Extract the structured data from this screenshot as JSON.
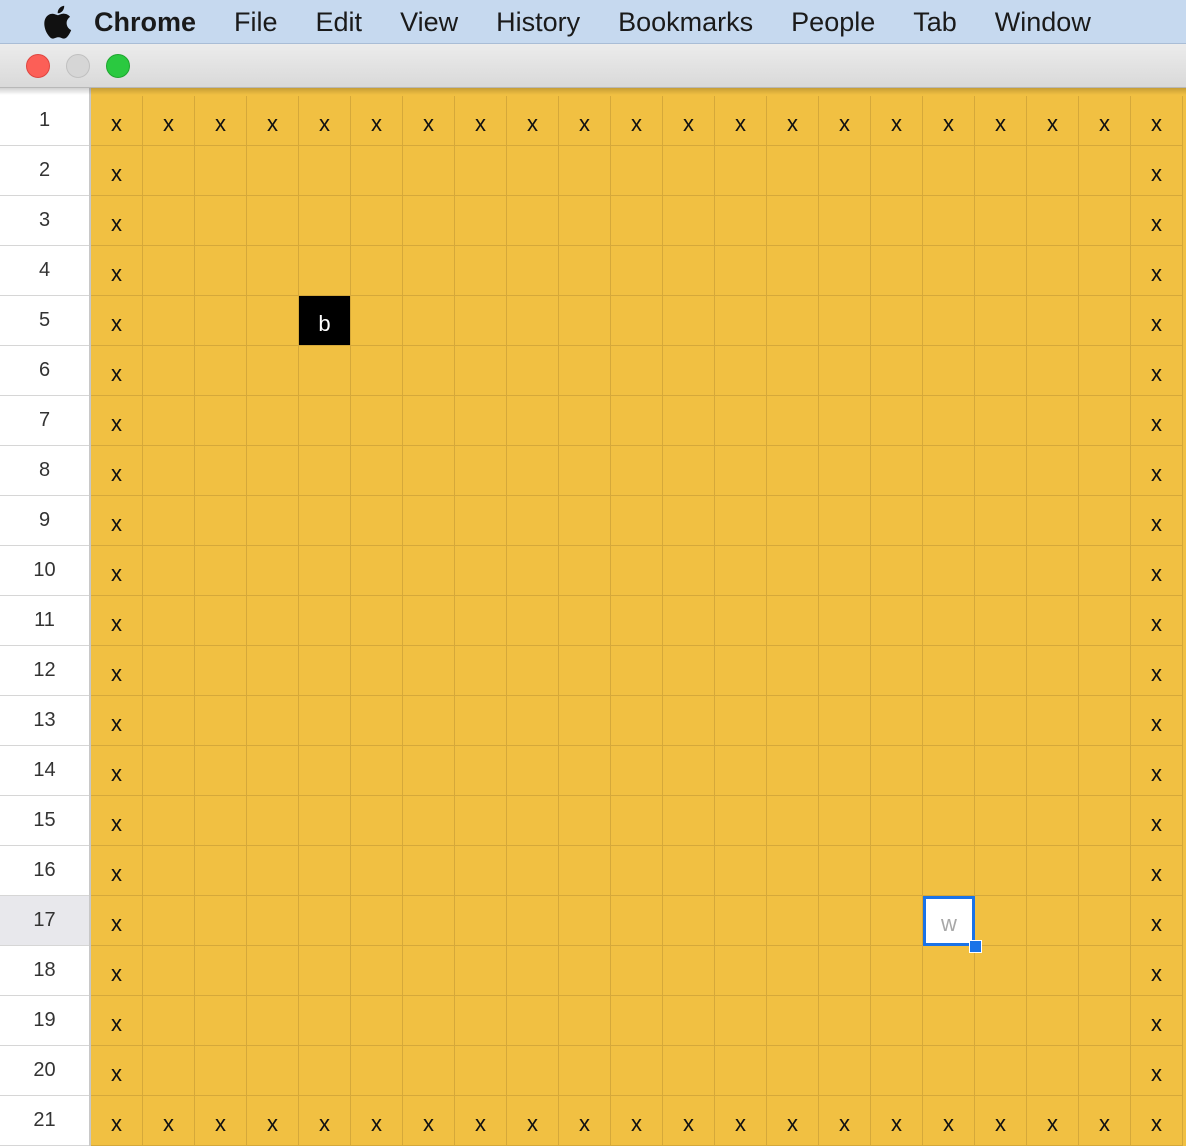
{
  "menubar": {
    "apple_icon": "apple-logo",
    "items": [
      "Chrome",
      "File",
      "Edit",
      "View",
      "History",
      "Bookmarks",
      "People",
      "Tab",
      "Window"
    ]
  },
  "window_controls": [
    "close",
    "minimize",
    "maximize"
  ],
  "colors": {
    "cell_background": "#f1c042",
    "grid_line": "#d5a83a",
    "highlight_cell": "#000000",
    "selection": "#1a73e8"
  },
  "sheet": {
    "columns": 21,
    "row_labels": [
      "1",
      "2",
      "3",
      "4",
      "5",
      "6",
      "7",
      "8",
      "9",
      "10",
      "11",
      "12",
      "13",
      "14",
      "15",
      "16",
      "17",
      "18",
      "19",
      "20",
      "21"
    ],
    "active_row": "17",
    "rows": [
      [
        "x",
        "x",
        "x",
        "x",
        "x",
        "x",
        "x",
        "x",
        "x",
        "x",
        "x",
        "x",
        "x",
        "x",
        "x",
        "x",
        "x",
        "x",
        "x",
        "x",
        "x"
      ],
      [
        "x",
        "",
        "",
        "",
        "",
        "",
        "",
        "",
        "",
        "",
        "",
        "",
        "",
        "",
        "",
        "",
        "",
        "",
        "",
        "",
        "x"
      ],
      [
        "x",
        "",
        "",
        "",
        "",
        "",
        "",
        "",
        "",
        "",
        "",
        "",
        "",
        "",
        "",
        "",
        "",
        "",
        "",
        "",
        "x"
      ],
      [
        "x",
        "",
        "",
        "",
        "",
        "",
        "",
        "",
        "",
        "",
        "",
        "",
        "",
        "",
        "",
        "",
        "",
        "",
        "",
        "",
        "x"
      ],
      [
        "x",
        "",
        "",
        "",
        "b",
        "",
        "",
        "",
        "",
        "",
        "",
        "",
        "",
        "",
        "",
        "",
        "",
        "",
        "",
        "",
        "x"
      ],
      [
        "x",
        "",
        "",
        "",
        "",
        "",
        "",
        "",
        "",
        "",
        "",
        "",
        "",
        "",
        "",
        "",
        "",
        "",
        "",
        "",
        "x"
      ],
      [
        "x",
        "",
        "",
        "",
        "",
        "",
        "",
        "",
        "",
        "",
        "",
        "",
        "",
        "",
        "",
        "",
        "",
        "",
        "",
        "",
        "x"
      ],
      [
        "x",
        "",
        "",
        "",
        "",
        "",
        "",
        "",
        "",
        "",
        "",
        "",
        "",
        "",
        "",
        "",
        "",
        "",
        "",
        "",
        "x"
      ],
      [
        "x",
        "",
        "",
        "",
        "",
        "",
        "",
        "",
        "",
        "",
        "",
        "",
        "",
        "",
        "",
        "",
        "",
        "",
        "",
        "",
        "x"
      ],
      [
        "x",
        "",
        "",
        "",
        "",
        "",
        "",
        "",
        "",
        "",
        "",
        "",
        "",
        "",
        "",
        "",
        "",
        "",
        "",
        "",
        "x"
      ],
      [
        "x",
        "",
        "",
        "",
        "",
        "",
        "",
        "",
        "",
        "",
        "",
        "",
        "",
        "",
        "",
        "",
        "",
        "",
        "",
        "",
        "x"
      ],
      [
        "x",
        "",
        "",
        "",
        "",
        "",
        "",
        "",
        "",
        "",
        "",
        "",
        "",
        "",
        "",
        "",
        "",
        "",
        "",
        "",
        "x"
      ],
      [
        "x",
        "",
        "",
        "",
        "",
        "",
        "",
        "",
        "",
        "",
        "",
        "",
        "",
        "",
        "",
        "",
        "",
        "",
        "",
        "",
        "x"
      ],
      [
        "x",
        "",
        "",
        "",
        "",
        "",
        "",
        "",
        "",
        "",
        "",
        "",
        "",
        "",
        "",
        "",
        "",
        "",
        "",
        "",
        "x"
      ],
      [
        "x",
        "",
        "",
        "",
        "",
        "",
        "",
        "",
        "",
        "",
        "",
        "",
        "",
        "",
        "",
        "",
        "",
        "",
        "",
        "",
        "x"
      ],
      [
        "x",
        "",
        "",
        "",
        "",
        "",
        "",
        "",
        "",
        "",
        "",
        "",
        "",
        "",
        "",
        "",
        "",
        "",
        "",
        "",
        "x"
      ],
      [
        "x",
        "",
        "",
        "",
        "",
        "",
        "",
        "",
        "",
        "",
        "",
        "",
        "",
        "",
        "",
        "",
        "w",
        "",
        "",
        "",
        "x"
      ],
      [
        "x",
        "",
        "",
        "",
        "",
        "",
        "",
        "",
        "",
        "",
        "",
        "",
        "",
        "",
        "",
        "",
        "",
        "",
        "",
        "",
        "x"
      ],
      [
        "x",
        "",
        "",
        "",
        "",
        "",
        "",
        "",
        "",
        "",
        "",
        "",
        "",
        "",
        "",
        "",
        "",
        "",
        "",
        "",
        "x"
      ],
      [
        "x",
        "",
        "",
        "",
        "",
        "",
        "",
        "",
        "",
        "",
        "",
        "",
        "",
        "",
        "",
        "",
        "",
        "",
        "",
        "",
        "x"
      ],
      [
        "x",
        "x",
        "x",
        "x",
        "x",
        "x",
        "x",
        "x",
        "x",
        "x",
        "x",
        "x",
        "x",
        "x",
        "x",
        "x",
        "x",
        "x",
        "x",
        "x",
        "x"
      ]
    ],
    "dark_cells": [
      {
        "row": 5,
        "col": 5
      }
    ],
    "selected_cell": {
      "row": 17,
      "col": 17
    }
  }
}
